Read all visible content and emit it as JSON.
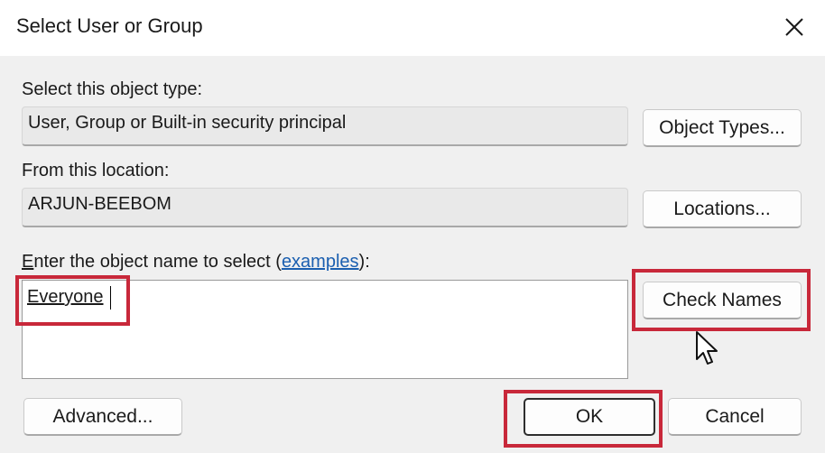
{
  "dialog": {
    "title": "Select User or Group"
  },
  "object_type": {
    "label": "Select this object type:",
    "value": "User, Group or Built-in security principal",
    "button": "Object Types..."
  },
  "location": {
    "label": "From this location:",
    "value": "ARJUN-BEEBOM",
    "button": "Locations..."
  },
  "object_name": {
    "label_accel": "E",
    "label_rest": "nter the object name to select (",
    "link": "examples",
    "label_end": "):",
    "value": "Everyone",
    "check_button": "Check Names"
  },
  "footer": {
    "advanced_button": "Advanced...",
    "ok_button": "OK",
    "cancel_button": "Cancel"
  },
  "colors": {
    "highlight": "#c8283a",
    "link": "#1b5fb0"
  },
  "icons": {
    "close": "close-icon",
    "cursor": "mouse-pointer-icon"
  }
}
